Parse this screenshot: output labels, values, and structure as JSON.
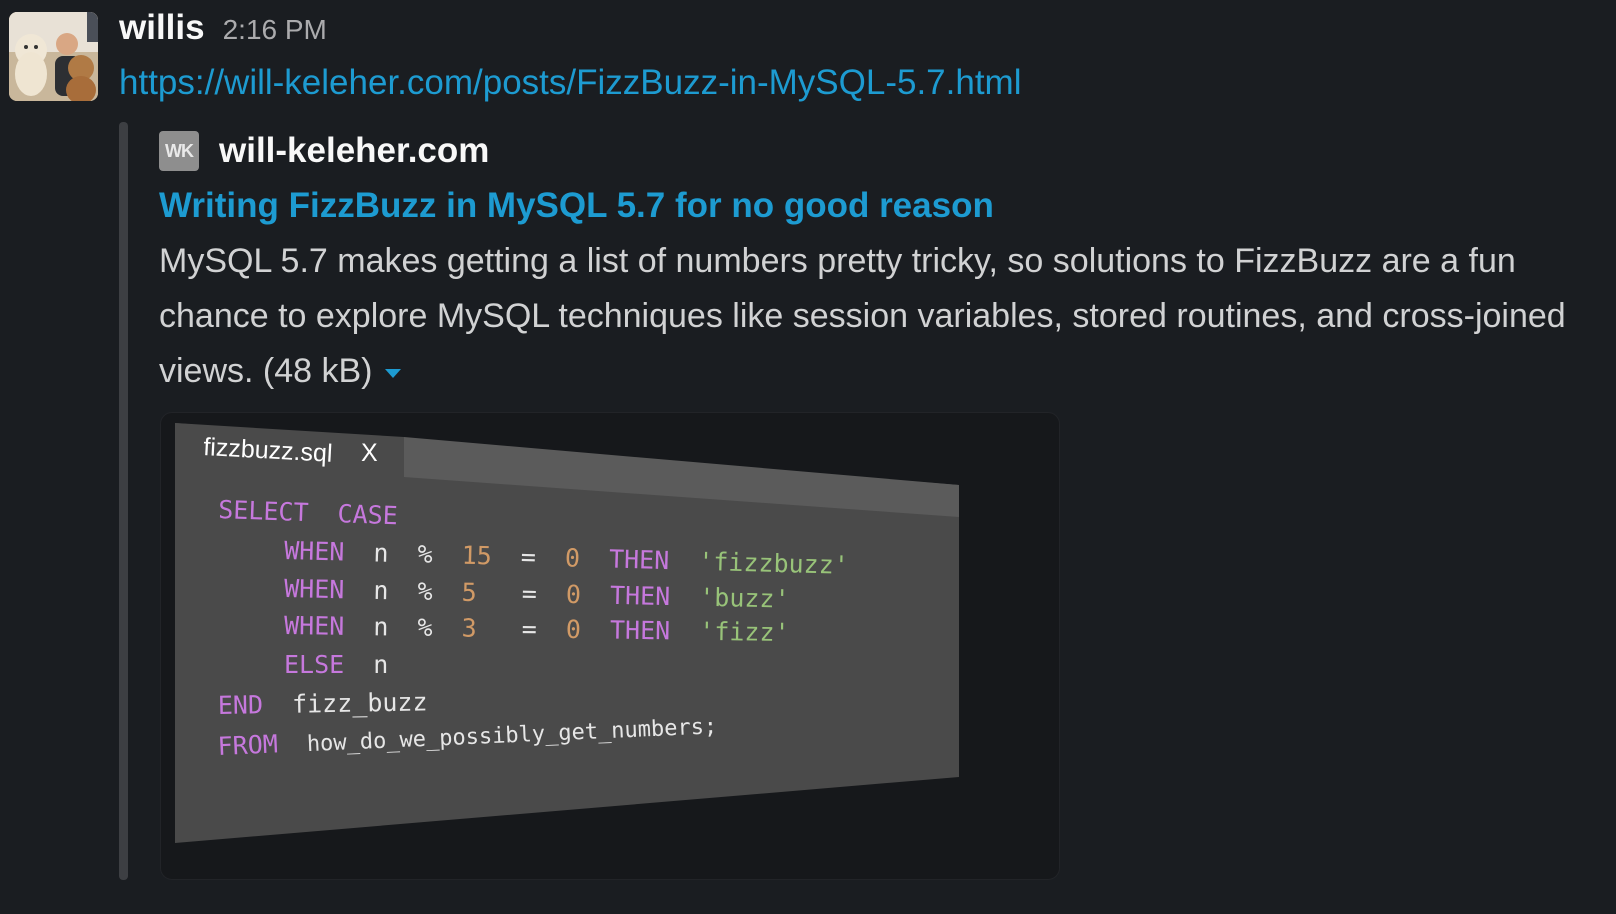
{
  "message": {
    "username": "willis",
    "timestamp": "2:16 PM",
    "link": "https://will-keleher.com/posts/FizzBuzz-in-MySQL-5.7.html"
  },
  "unfurl": {
    "site_icon_text": "WK",
    "site_name": "will-keleher.com",
    "title": "Writing FizzBuzz in MySQL 5.7 for no good reason",
    "description": "MySQL 5.7 makes getting a list of numbers pretty tricky, so solutions to FizzBuzz are a fun chance to explore MySQL techniques like session variables, stored routines, and cross-joined views.",
    "size": "(48 kB)"
  },
  "preview": {
    "tab_label": "fizzbuzz.sql",
    "tab_close": "X",
    "code": {
      "select": "SELECT",
      "case": "CASE",
      "when": "WHEN",
      "then": "THEN",
      "else": "ELSE",
      "end": "END",
      "from": "FROM",
      "n": "n",
      "mod": "%",
      "eq": "=",
      "zero": "0",
      "n15": "15",
      "n5": "5",
      "n3": "3",
      "s_fizzbuzz": "'fizzbuzz'",
      "s_buzz": "'buzz'",
      "s_fizz": "'fizz'",
      "alias": "fizz_buzz",
      "table": "how_do_we_possibly_get_numbers;"
    }
  },
  "colors": {
    "link": "#1d9bd1",
    "keyword": "#c678dd",
    "number": "#d19a66",
    "string": "#98c379"
  }
}
